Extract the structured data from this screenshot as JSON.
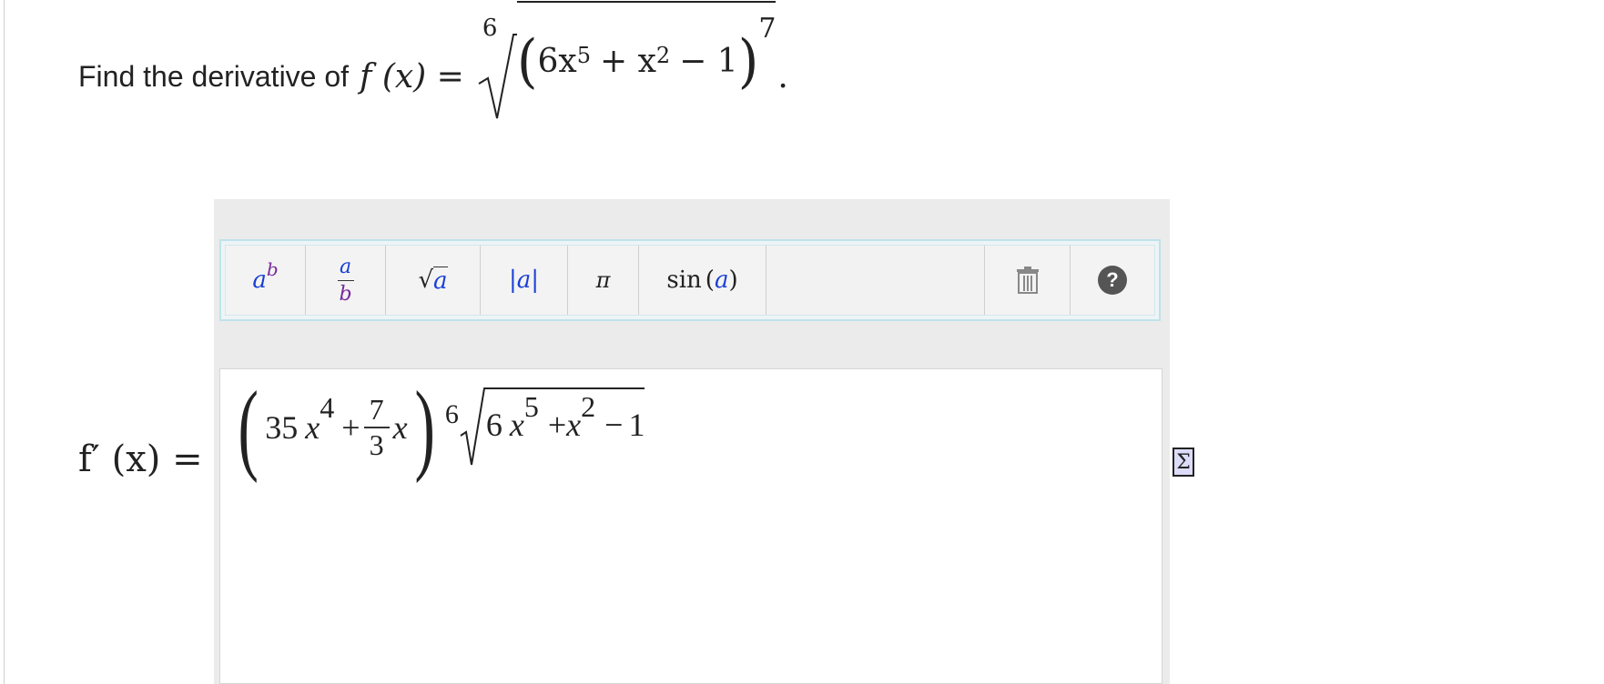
{
  "question": {
    "prompt": "Find the derivative of",
    "func_lhs": "f (x) =",
    "rad_index": "6",
    "inner": "6x",
    "inner_exp1": "5",
    "inner_mid": "+ x",
    "inner_exp2": "2",
    "inner_end": "− 1",
    "outer_exp": "7",
    "period": "."
  },
  "toolbar": {
    "power": {
      "base": "a",
      "exp": "b"
    },
    "fraction": {
      "num": "a",
      "den": "b"
    },
    "sqrt": {
      "symbol": "√",
      "arg": "a"
    },
    "abs": {
      "text": "|a|"
    },
    "pi": {
      "text": "π"
    },
    "sin": {
      "fn": "sin",
      "arg": "a"
    },
    "icons": [
      "trash-icon",
      "help-icon"
    ]
  },
  "answer": {
    "label": "f′ (x) =",
    "coef": "35",
    "x1": "x",
    "exp1": "4",
    "plus": "+",
    "frac_num": "7",
    "frac_den": "3",
    "x2": "x",
    "root_index": "6",
    "rad_coef": "6",
    "rad_x1": "x",
    "rad_exp1": "5",
    "rad_plus": "+",
    "rad_x2": "x",
    "rad_exp2": "2",
    "rad_minus": "−",
    "rad_one": "1"
  },
  "sigma_icon": {
    "symbol": "Σ"
  }
}
